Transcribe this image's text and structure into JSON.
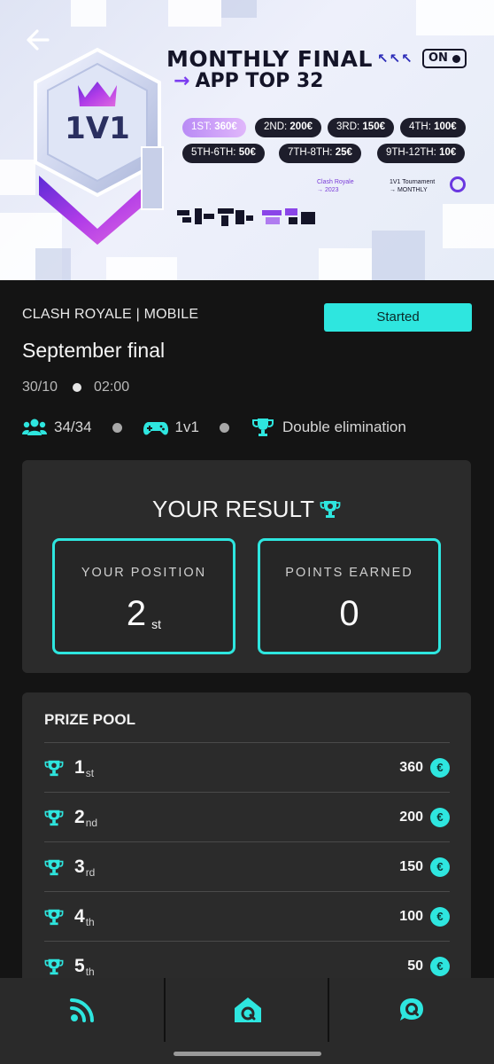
{
  "banner": {
    "title_line1": "MONTHLY FINAL",
    "title_line2_arrow": "→",
    "title_line2": "APP TOP 32",
    "badge_text": "1V1",
    "arrows": "↖↖↖",
    "toggle": "ON",
    "prizes": [
      {
        "label": "1ST:",
        "value": "360€"
      },
      {
        "label": "2ND:",
        "value": "200€"
      },
      {
        "label": "3RD:",
        "value": "150€"
      },
      {
        "label": "4TH:",
        "value": "100€"
      },
      {
        "label": "5TH-6TH:",
        "value": "50€"
      },
      {
        "label": "7TH-8TH:",
        "value": "25€"
      },
      {
        "label": "9TH-12TH:",
        "value": "10€"
      }
    ],
    "logo1_line1": "Clash Royale",
    "logo1_line2": "→ 2023",
    "logo2_line1": "1V1 Tournament",
    "logo2_line2": "→ MONTHLY"
  },
  "tournament": {
    "game": "CLASH ROYALE | MOBILE",
    "status": "Started",
    "title": "September final",
    "date": "30/10",
    "time": "02:00",
    "players": "34/34",
    "mode": "1v1",
    "format": "Double elimination"
  },
  "result": {
    "title": "YOUR RESULT",
    "position_label": "YOUR POSITION",
    "position_value": "2",
    "position_suffix": "st",
    "points_label": "POINTS EARNED",
    "points_value": "0"
  },
  "prize_pool": {
    "title": "PRIZE POOL",
    "rows": [
      {
        "rank": "1",
        "suffix": "st",
        "amount": "360",
        "currency": "€"
      },
      {
        "rank": "2",
        "suffix": "nd",
        "amount": "200",
        "currency": "€"
      },
      {
        "rank": "3",
        "suffix": "rd",
        "amount": "150",
        "currency": "€"
      },
      {
        "rank": "4",
        "suffix": "th",
        "amount": "100",
        "currency": "€"
      },
      {
        "rank": "5",
        "suffix": "th",
        "amount": "50",
        "currency": "€"
      }
    ]
  },
  "nav": {
    "items": [
      "feed-icon",
      "home-icon",
      "chat-icon"
    ]
  },
  "colors": {
    "accent": "#2ee6df",
    "background": "#141414",
    "card": "#2b2b2b"
  }
}
